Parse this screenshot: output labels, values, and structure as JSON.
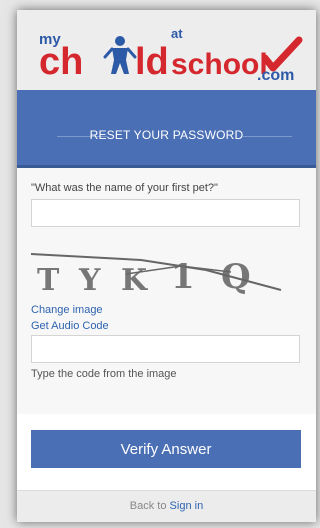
{
  "logo": {
    "my": "my",
    "ch": "ch",
    "ld": "ld",
    "at": "at",
    "school": "school",
    "dotcom": ".com",
    "colors": {
      "red": "#d5282e",
      "blue": "#2d5aa7"
    }
  },
  "banner": {
    "title": "RESET YOUR PASSWORD"
  },
  "form": {
    "question": "\"What was the name of your first pet?\"",
    "answer_value": "",
    "captcha_text": "TYK1Q",
    "change_image": "Change image",
    "audio_code": "Get Audio Code",
    "code_value": "",
    "code_hint": "Type the code from the image"
  },
  "actions": {
    "verify_label": "Verify Answer"
  },
  "footer": {
    "prefix": "Back to",
    "sign_in": "Sign in"
  },
  "colors": {
    "accent": "#4a6fb5",
    "link": "#2f63b0"
  }
}
